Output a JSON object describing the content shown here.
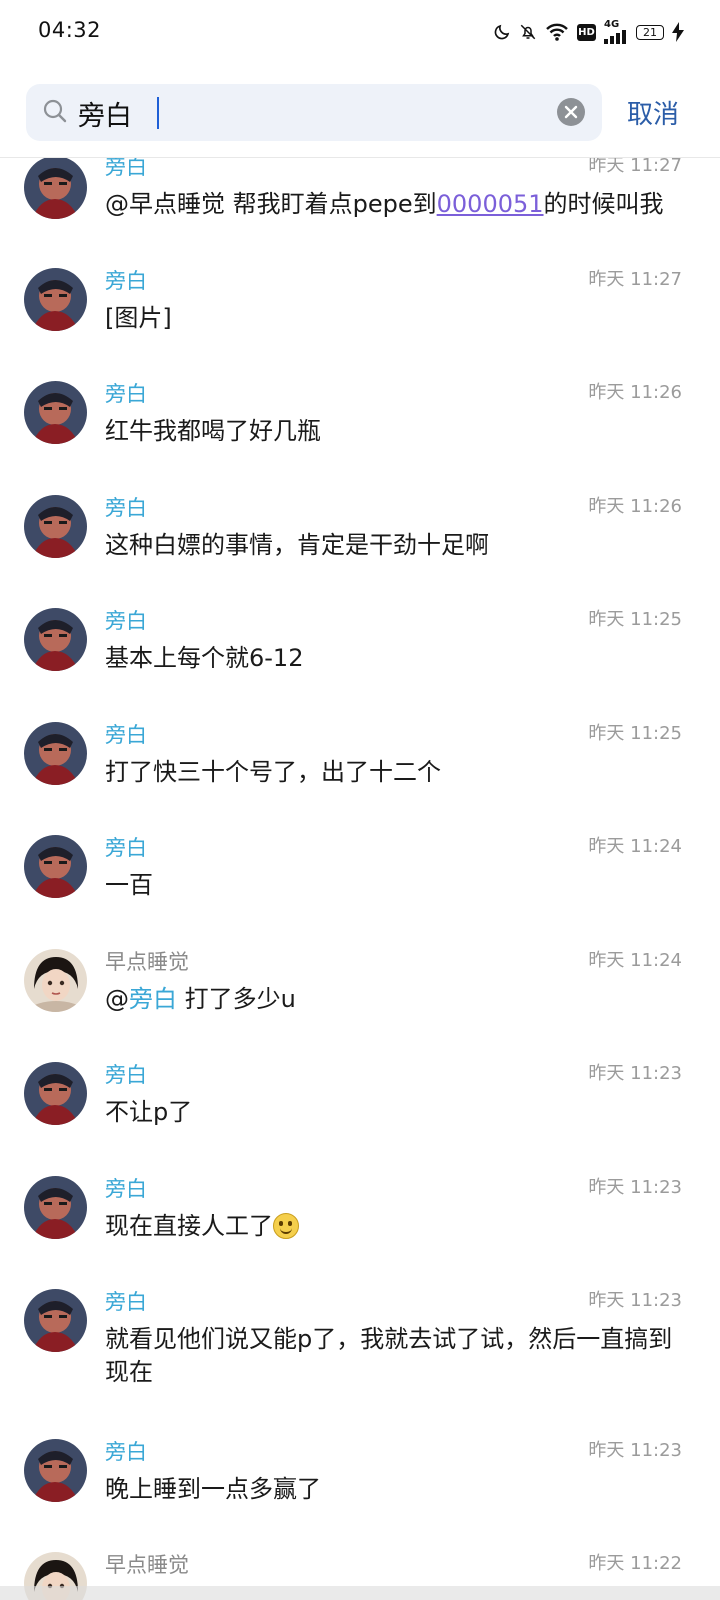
{
  "status_bar": {
    "time": "04:32",
    "icons": [
      "moon-icon",
      "mute-icon",
      "wifi-icon",
      "hd-icon",
      "signal-icon",
      "battery-icon",
      "charging-icon"
    ],
    "hd_label": "HD",
    "network_label": "4G",
    "battery_level": "21"
  },
  "search": {
    "query": "旁白",
    "cancel_label": "取消"
  },
  "colors": {
    "self_name": "#3aa7d6",
    "other_name": "#8a8a8a",
    "timestamp": "#9b9b9b",
    "link": "#7b5fd9",
    "cancel": "#2b5da8",
    "search_bg": "#eef2f9"
  },
  "messages": [
    {
      "sender": "旁白",
      "time": "昨天 11:27",
      "pre": "@早点睡觉 帮我盯着点pepe到",
      "link": "0000051",
      "post": "的时候叫我"
    },
    {
      "sender": "旁白",
      "time": "昨天 11:27",
      "text": "[图片]"
    },
    {
      "sender": "旁白",
      "time": "昨天 11:26",
      "text": "红牛我都喝了好几瓶"
    },
    {
      "sender": "旁白",
      "time": "昨天 11:26",
      "text": "这种白嫖的事情，肯定是干劲十足啊"
    },
    {
      "sender": "旁白",
      "time": "昨天 11:25",
      "text": "基本上每个就6-12"
    },
    {
      "sender": "旁白",
      "time": "昨天 11:25",
      "text": "打了快三十个号了，出了十二个"
    },
    {
      "sender": "旁白",
      "time": "昨天 11:24",
      "text": "一百"
    },
    {
      "sender": "早点睡觉",
      "time": "昨天 11:24",
      "at": "@",
      "mention": "旁白",
      "post": " 打了多少u"
    },
    {
      "sender": "旁白",
      "time": "昨天 11:23",
      "text": "不让p了"
    },
    {
      "sender": "旁白",
      "time": "昨天 11:23",
      "text": "现在直接人工了",
      "emoji": "smile-emoji"
    },
    {
      "sender": "旁白",
      "time": "昨天 11:23",
      "text": "就看见他们说又能p了，我就去试了试，然后一直搞到现在"
    },
    {
      "sender": "旁白",
      "time": "昨天 11:23",
      "text": "晚上睡到一点多赢了"
    },
    {
      "sender": "早点睡觉",
      "time": "昨天 11:22"
    }
  ]
}
